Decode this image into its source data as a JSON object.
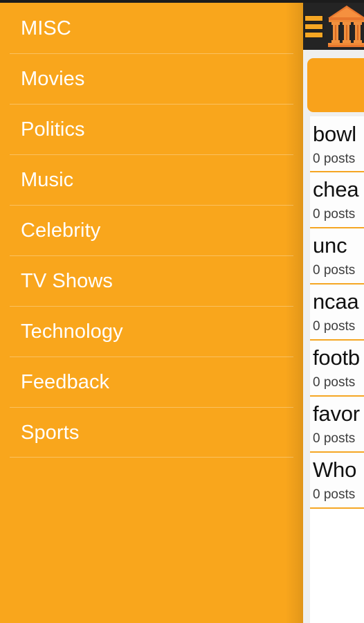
{
  "app": {
    "header": {
      "menu_icon": "hamburger-menu-icon",
      "logo_icon": "museum-building-logo"
    },
    "colors": {
      "accent_orange": "#f9a61c",
      "header_dark": "#242424",
      "divider_orange": "#f5a623",
      "drawer_text": "#ffffff",
      "list_background": "#efefef"
    }
  },
  "drawer": {
    "items": [
      {
        "label": "MISC"
      },
      {
        "label": "Movies"
      },
      {
        "label": "Politics"
      },
      {
        "label": "Music"
      },
      {
        "label": "Celebrity"
      },
      {
        "label": "TV Shows"
      },
      {
        "label": "Technology"
      },
      {
        "label": "Feedback"
      },
      {
        "label": "Sports"
      }
    ]
  },
  "main": {
    "posts": [
      {
        "title": "bowl",
        "meta": "0 posts"
      },
      {
        "title": "chea",
        "meta": "0 posts"
      },
      {
        "title": "unc",
        "meta": "0 posts"
      },
      {
        "title": "ncaa",
        "meta": "0 posts"
      },
      {
        "title": "footb",
        "meta": "0 posts"
      },
      {
        "title": "favor",
        "meta": "0 posts"
      },
      {
        "title": "Who",
        "meta": "0 posts"
      }
    ]
  }
}
